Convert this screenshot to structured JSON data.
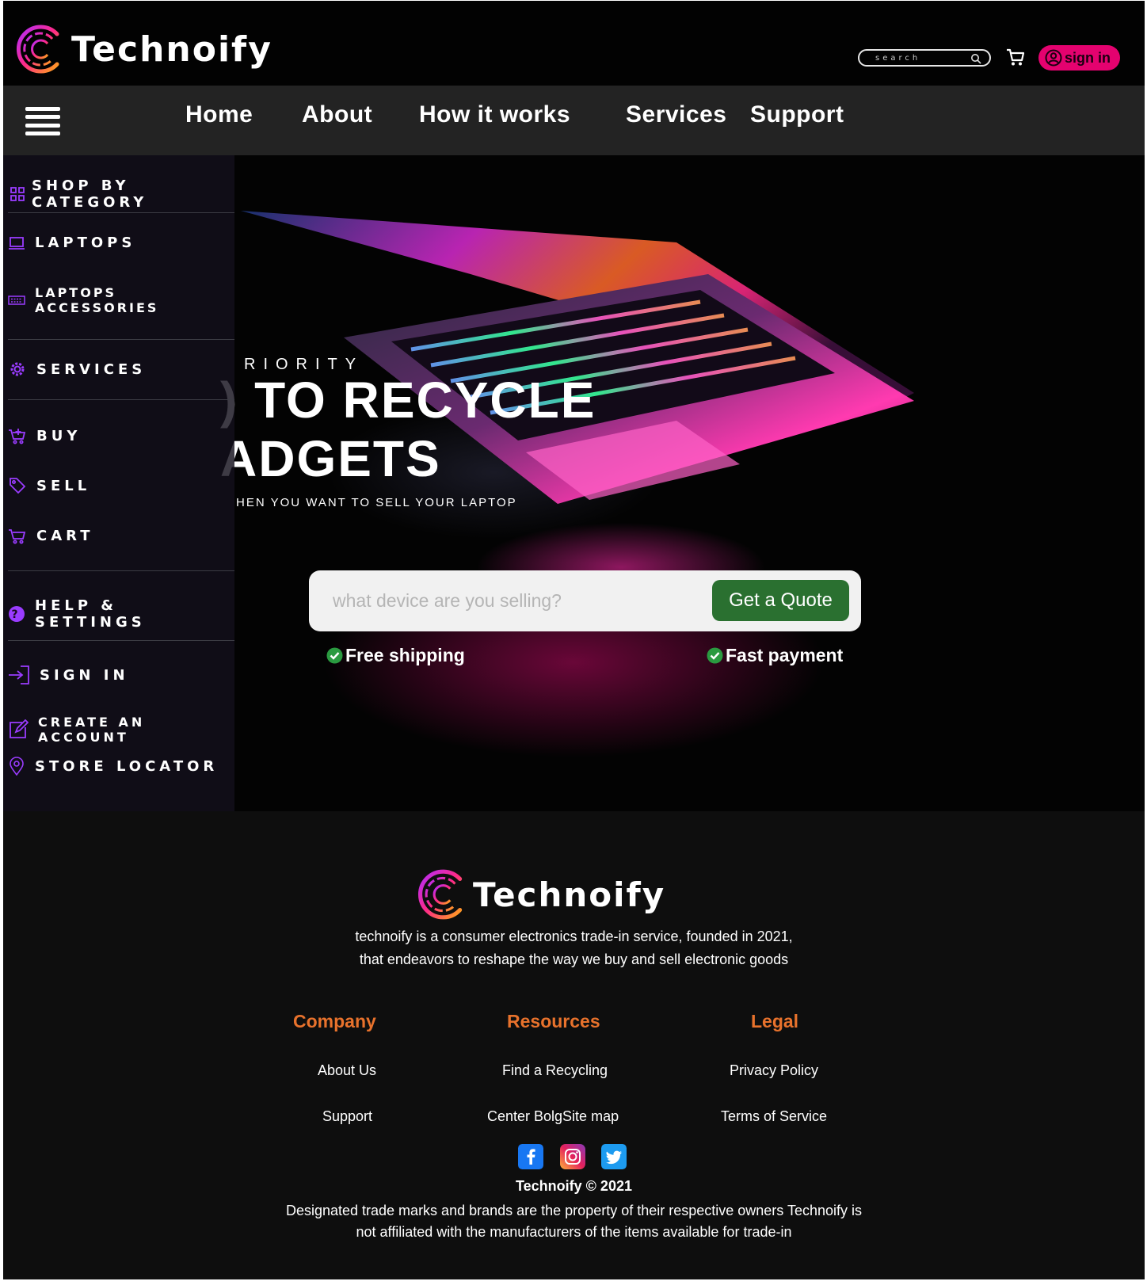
{
  "brand": {
    "name": "Technoify",
    "accent": "#e4026f",
    "orange": "#e8722c",
    "green": "#2a7030"
  },
  "header": {
    "search_placeholder": "search",
    "signin_label": "sign in"
  },
  "nav": {
    "items": [
      "Home",
      "About",
      "How it works",
      "Services",
      "Support"
    ]
  },
  "sidebar": {
    "items": [
      {
        "label": "SHOP BY CATEGORY",
        "icon": "grid-icon"
      },
      {
        "label": "LAPTOPS",
        "icon": "laptop-icon"
      },
      {
        "label": "LAPTOPS ACCESSORIES",
        "icon": "keyboard-icon"
      },
      {
        "label": "SERVICES",
        "icon": "gear-icon"
      },
      {
        "label": "BUY",
        "icon": "cart-add-icon"
      },
      {
        "label": "SELL",
        "icon": "tag-icon"
      },
      {
        "label": "CART",
        "icon": "cart-icon"
      },
      {
        "label": "HELP & SETTINGS",
        "icon": "help-icon"
      },
      {
        "label": "SIGN IN",
        "icon": "sign-in-icon"
      },
      {
        "label": "CREATE AN ACCOUNT",
        "icon": "edit-icon"
      },
      {
        "label": "STORE LOCATOR",
        "icon": "location-pin-icon"
      }
    ]
  },
  "hero": {
    "kicker": "RIORITY",
    "title_line1": ") TO RECYCLE",
    "title_line2": "ADGETS",
    "subtitle": "HEN YOU WANT TO SELL YOUR LAPTOP",
    "input_placeholder": "what device are you selling?",
    "cta_label": "Get a Quote",
    "perks": [
      "Free shipping",
      "Fast payment"
    ]
  },
  "footer": {
    "about_line1": "technoify is a consumer electronics trade-in service, founded in 2021,",
    "about_line2": "that endeavors to reshape the way we buy and sell electronic goods",
    "columns": [
      {
        "heading": "Company",
        "links": [
          "About Us",
          "Support"
        ]
      },
      {
        "heading": "Resources",
        "links": [
          "Find a Recycling",
          "Center BolgSite map"
        ]
      },
      {
        "heading": "Legal",
        "links": [
          "Privacy Policy",
          "Terms of Service"
        ]
      }
    ],
    "social": [
      "facebook-icon",
      "instagram-icon",
      "twitter-icon"
    ],
    "copyright": "Technoify © 2021",
    "legal_line1": "Designated trade marks and brands are the property of their respective owners Technoify is",
    "legal_line2": "not affiliated with the manufacturers of the items available for trade-in"
  }
}
